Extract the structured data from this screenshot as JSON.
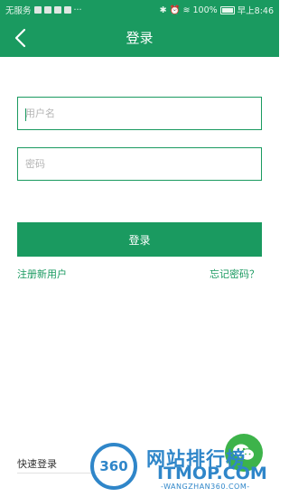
{
  "status_bar": {
    "carrier": "无服务",
    "battery": "100%",
    "time": "早上8:46"
  },
  "app_bar": {
    "title": "登录",
    "back_icon": "chevron-left-icon"
  },
  "form": {
    "username_placeholder": "用户名",
    "password_placeholder": "密码",
    "login_label": "登录"
  },
  "links": {
    "register": "注册新用户",
    "forgot_password": "忘记密码？"
  },
  "quick_login": {
    "label": "快速登录",
    "wechat_icon": "wechat-icon"
  },
  "watermark": {
    "badge": "360",
    "title": "网站排行榜",
    "domain": "ITMOP.COM",
    "subdomain": "-WANGZHAN360.COM-"
  },
  "colors": {
    "primary": "#1a9a60",
    "wechat": "#3db34a",
    "watermark": "#2f86c9"
  }
}
